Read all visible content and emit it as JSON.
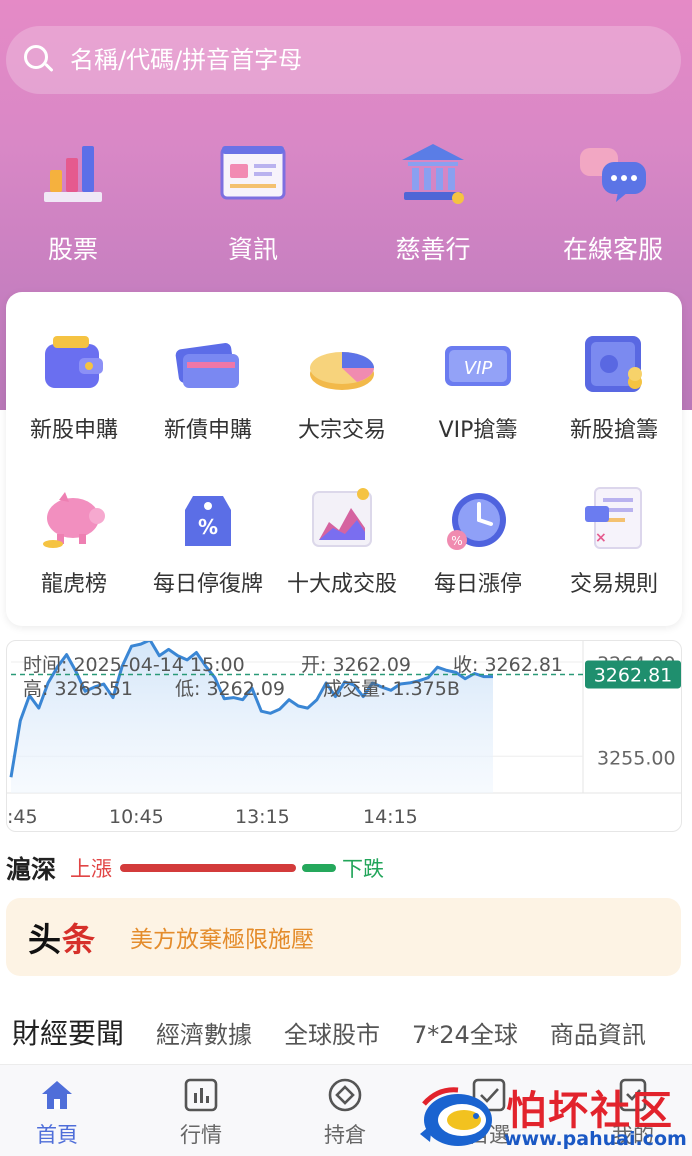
{
  "search": {
    "placeholder": "名稱/代碼/拼音首字母"
  },
  "quick_links": [
    {
      "label": "股票",
      "icon": "bar-chart-icon"
    },
    {
      "label": "資訊",
      "icon": "news-board-icon"
    },
    {
      "label": "慈善行",
      "icon": "bank-building-icon"
    },
    {
      "label": "在線客服",
      "icon": "chat-bubbles-icon"
    }
  ],
  "services": [
    {
      "label": "新股申購",
      "icon": "wallet-icon"
    },
    {
      "label": "新債申購",
      "icon": "cards-icon"
    },
    {
      "label": "大宗交易",
      "icon": "pie-chart-icon"
    },
    {
      "label": "VIP搶籌",
      "icon": "vip-card-icon"
    },
    {
      "label": "新股搶籌",
      "icon": "safe-icon"
    },
    {
      "label": "龍虎榜",
      "icon": "piggy-bank-icon"
    },
    {
      "label": "每日停復牌",
      "icon": "discount-tag-icon"
    },
    {
      "label": "十大成交股",
      "icon": "area-chart-icon"
    },
    {
      "label": "每日漲停",
      "icon": "alarm-clock-icon"
    },
    {
      "label": "交易規則",
      "icon": "rules-document-icon"
    }
  ],
  "chart_data": {
    "type": "line",
    "info": {
      "time": "时间: 2025-04-14 15:00",
      "open": "开: 3262.09",
      "close": "收: 3262.81",
      "high": "高: 3263.51",
      "low": "低: 3262.09",
      "volume": "成交量: 1.375B"
    },
    "x_ticks": [
      ":45",
      "10:45",
      "13:15",
      "14:15"
    ],
    "y_ticks": [
      "3264.00",
      "3255.00"
    ],
    "y_tick_values": [
      3264.0,
      3255.0
    ],
    "current_price": "3262.81",
    "current_value": 3262.81,
    "ylim": [
      3251.5,
      3266.0
    ],
    "values": [
      3253.0,
      3258.4,
      3260.8,
      3259.6,
      3262.0,
      3263.5,
      3264.7,
      3263.1,
      3261.2,
      3261.6,
      3261.9,
      3260.6,
      3263.6,
      3265.5,
      3265.7,
      3266.1,
      3264.6,
      3265.2,
      3264.6,
      3264.2,
      3264.9,
      3263.6,
      3262.5,
      3260.5,
      3260.6,
      3260.4,
      3261.5,
      3259.3,
      3259.1,
      3259.5,
      3260.4,
      3259.8,
      3259.6,
      3260.4,
      3262.0,
      3260.7,
      3262.1,
      3261.8,
      3260.7,
      3262.0,
      3261.6,
      3261.3,
      3261.9,
      3262.0,
      3262.2,
      3262.5,
      3263.5,
      3263.2,
      3263.0,
      3262.4,
      3262.9,
      3262.6,
      3262.6
    ],
    "line_color": "#3a86d4",
    "price_tag_color": "#1f8f6e"
  },
  "market": {
    "title": "滬深",
    "up_label": "上漲",
    "down_label": "下跌",
    "up_ratio": 0.88,
    "up_color": "#d33b3b",
    "down_color": "#25a85c"
  },
  "headline": {
    "logo_first": "头",
    "logo_second": "条",
    "text": "美方放棄極限施壓"
  },
  "tabs": [
    "財經要聞",
    "經濟數據",
    "全球股市",
    "7*24全球",
    "商品資訊"
  ],
  "bottom_nav": [
    {
      "label": "首頁",
      "icon": "home-icon",
      "active": true
    },
    {
      "label": "行情",
      "icon": "market-chart-icon",
      "active": false
    },
    {
      "label": "持倉",
      "icon": "position-circle-icon",
      "active": false
    },
    {
      "label": "自選",
      "icon": "watchlist-icon",
      "active": false
    },
    {
      "label": "我的",
      "icon": "profile-icon",
      "active": false
    }
  ],
  "watermark": {
    "title": "怕坏社区",
    "url": "www.pahuai.com"
  }
}
